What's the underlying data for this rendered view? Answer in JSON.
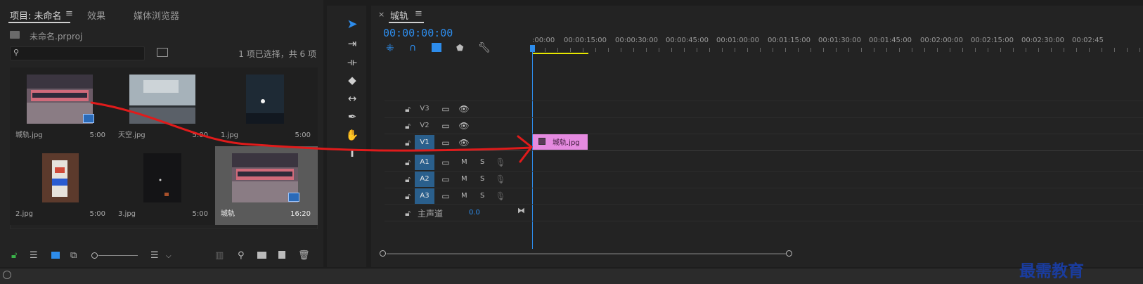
{
  "project_panel": {
    "tabs": [
      {
        "label": "项目: 未命名",
        "active": true
      },
      {
        "label": "效果",
        "active": false
      },
      {
        "label": "媒体浏览器",
        "active": false
      }
    ],
    "menu_icon": "hamburger-icon",
    "project_file": "未命名.prproj",
    "search": {
      "value": "",
      "placeholder": ""
    },
    "selection_status": "1 项已选择，共 6 项",
    "items": [
      {
        "name": "城轨.jpg",
        "duration": "5:00",
        "selected": false,
        "thumb": "night-street-bus"
      },
      {
        "name": "天空.jpg",
        "duration": "5:00",
        "selected": false,
        "thumb": "cloudy-sky-lake"
      },
      {
        "name": "1.jpg",
        "duration": "5:00",
        "selected": false,
        "thumb": "moon-night"
      },
      {
        "name": "2.jpg",
        "duration": "5:00",
        "selected": false,
        "thumb": "drink-cup"
      },
      {
        "name": "3.jpg",
        "duration": "5:00",
        "selected": false,
        "thumb": "dark-night"
      },
      {
        "name": "城轨",
        "duration": "16:20",
        "selected": true,
        "thumb": "night-street-bus"
      }
    ]
  },
  "tools": [
    "selection-tool-icon",
    "track-select-tool-icon",
    "ripple-edit-tool-icon",
    "razor-tool-icon",
    "slip-tool-icon",
    "pen-tool-icon",
    "hand-tool-icon",
    "type-tool-icon"
  ],
  "timeline": {
    "sequence_name": "城轨",
    "timecode": "00:00:00:00",
    "ruler_ticks": [
      ":00:00",
      "00:00:15:00",
      "00:00:30:00",
      "00:00:45:00",
      "00:01:00:00",
      "00:01:15:00",
      "00:01:30:00",
      "00:01:45:00",
      "00:02:00:00",
      "00:02:15:00",
      "00:02:30:00",
      "00:02:45"
    ],
    "video_tracks": [
      {
        "label": "V3",
        "targeted": false
      },
      {
        "label": "V2",
        "targeted": false
      },
      {
        "label": "V1",
        "targeted": true
      }
    ],
    "audio_tracks": [
      {
        "label": "A1",
        "m": "M",
        "s": "S"
      },
      {
        "label": "A2",
        "m": "M",
        "s": "S"
      },
      {
        "label": "A3",
        "m": "M",
        "s": "S"
      }
    ],
    "master": {
      "label": "主声道",
      "value": "0.0"
    },
    "clip": {
      "name": "城轨.jpg",
      "track": "V1",
      "color": "#e58ae0"
    }
  },
  "watermark": "最需教育",
  "colors": {
    "accent": "#2d8ceb",
    "clip": "#e58ae0",
    "arrow": "#e01b1b",
    "work_area": "#e8e800"
  }
}
